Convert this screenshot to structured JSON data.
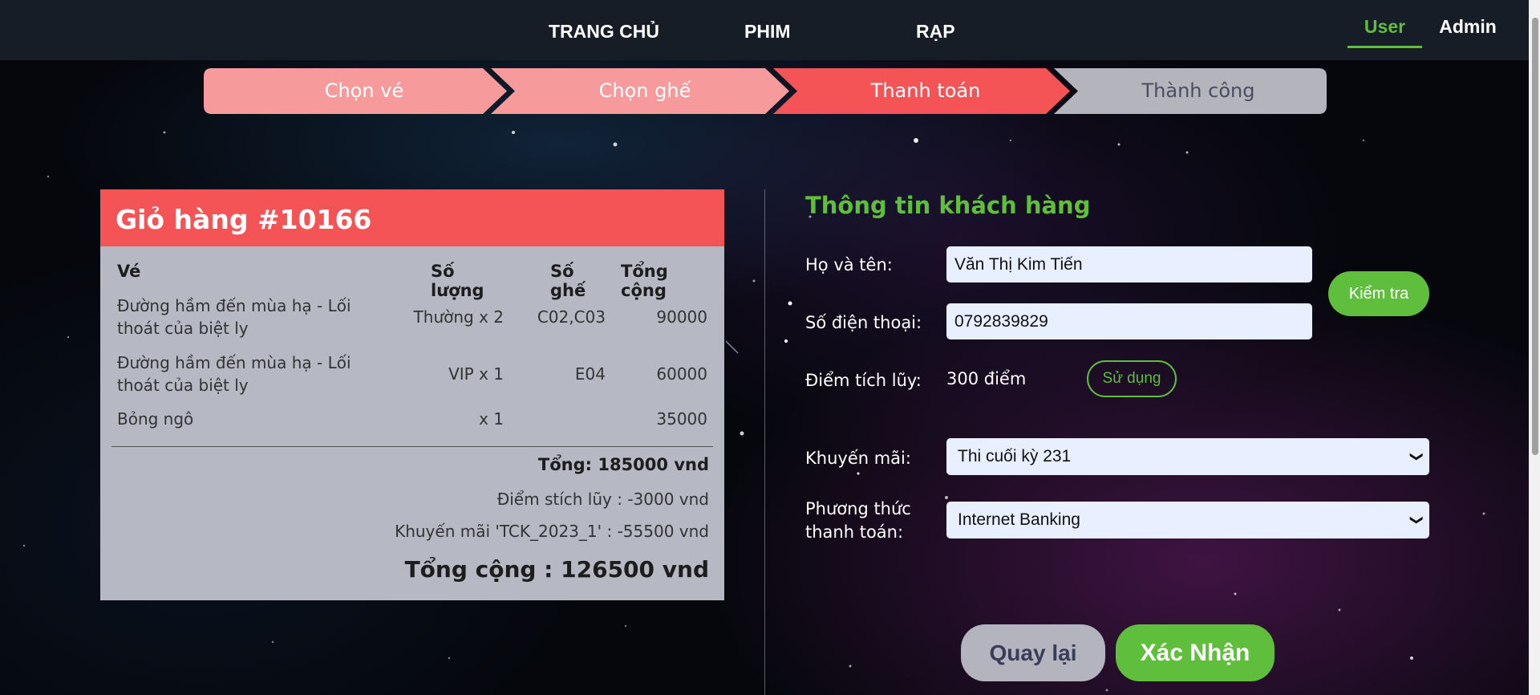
{
  "nav": {
    "home": "TRANG CHỦ",
    "movies": "PHIM",
    "cinema": "RẠP",
    "user_tab": "User",
    "admin_tab": "Admin"
  },
  "steps": [
    {
      "label": "Chọn vé",
      "state": "done",
      "color": "#f79a9b",
      "text_color": "#ffffff"
    },
    {
      "label": "Chọn ghế",
      "state": "done",
      "color": "#f79a9b",
      "text_color": "#ffffff"
    },
    {
      "label": "Thanh toán",
      "state": "active",
      "color": "#f55456",
      "text_color": "#ffffff"
    },
    {
      "label": "Thành công",
      "state": "pending",
      "color": "#b3b4bc",
      "text_color": "#4a4d60"
    }
  ],
  "cart": {
    "title": "Giỏ hàng #10166",
    "columns": [
      "Vé",
      "Số lượng",
      "Số ghế",
      "Tổng cộng"
    ],
    "rows": [
      {
        "item": "Đường hầm đến mùa hạ - Lối thoát của biệt ly",
        "qty": "Thường x 2",
        "seats": "C02,C03",
        "total": "90000"
      },
      {
        "item": "Đường hầm đến mùa hạ - Lối thoát của biệt ly",
        "qty": "VIP x 1",
        "seats": "E04",
        "total": "60000"
      },
      {
        "item": "Bỏng ngô",
        "qty": "x 1",
        "seats": "",
        "total": "35000"
      }
    ],
    "subtotal": "Tổng: 185000 vnd",
    "points_discount": "Điểm stích lũy : -3000 vnd",
    "promo_discount": "Khuyến mãi 'TCK_2023_1' : -55500 vnd",
    "grand_total": "Tổng cộng : 126500 vnd"
  },
  "form": {
    "title": "Thông tin khách hàng",
    "name_label": "Họ và tên:",
    "name_value": "Văn Thị Kim Tiến",
    "phone_label": "Số điện thoại:",
    "phone_value": "0792839829",
    "check_button": "Kiểm tra",
    "points_label": "Điểm tích lũy:",
    "points_value": "300 điểm",
    "use_button": "Sử dụng",
    "promo_label": "Khuyến mãi:",
    "promo_selected": "Thi cuối kỳ 231",
    "payment_label_line1": "Phương thức",
    "payment_label_line2": "thanh toán:",
    "payment_selected": "Internet Banking",
    "back_button": "Quay lại",
    "confirm_button": "Xác Nhận"
  }
}
